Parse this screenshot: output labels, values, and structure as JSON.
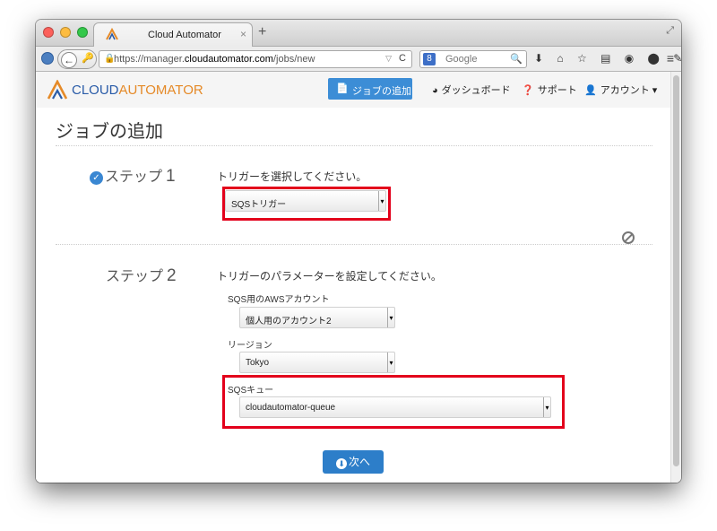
{
  "browser": {
    "tab_title": "Cloud Automator",
    "tab_close": "×",
    "new_tab": "+",
    "url_prefix": "https://manager.",
    "url_domain": "cloudautomator.com",
    "url_path": "/jobs/new",
    "search_engine": "Google",
    "nav_icons": "⬇ ⌂ ☆ ▤ ◉ ⬤ ✎ ⇅",
    "menu_icon": "≡"
  },
  "site": {
    "brand_a": "CLOUD",
    "brand_b": "AUTOMATOR",
    "nav": {
      "add_job": "ジョブの追加",
      "dashboard": "ダッシュボード",
      "support": "サポート",
      "account": "アカウント ▾"
    },
    "colors": {
      "accent": "#3c8dd6",
      "brand_blue": "#2a5ca8",
      "brand_orange": "#e58a28",
      "highlight": "#e3001b"
    }
  },
  "form": {
    "page_title": "ジョブの追加",
    "step1": {
      "label": "ステップ",
      "number": "1",
      "description": "トリガーを選択してください。",
      "trigger_value": "SQSトリガー"
    },
    "step2": {
      "label": "ステップ",
      "number": "2",
      "description": "トリガーのパラメーターを設定してください。",
      "account_label": "SQS用のAWSアカウント",
      "account_value": "個人用のアカウント2",
      "region_label": "リージョン",
      "region_value": "Tokyo",
      "queue_label": "SQSキュー",
      "queue_value": "cloudautomator-queue"
    },
    "next_button": "次へ"
  }
}
